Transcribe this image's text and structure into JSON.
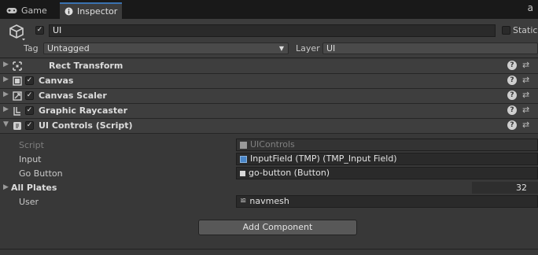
{
  "tabs": [
    {
      "label": "Game",
      "icon": "gamepad-icon"
    },
    {
      "label": "Inspector",
      "icon": "info-icon"
    }
  ],
  "tab_right_glyph": "a",
  "object": {
    "active": true,
    "name": "UI",
    "static_label": "Static",
    "tag_label": "Tag",
    "tag_value": "Untagged",
    "layer_label": "Layer",
    "layer_value": "UI"
  },
  "components": [
    {
      "name": "Rect Transform",
      "icon": "rect-transform-icon",
      "has_checkbox": false,
      "expanded": false
    },
    {
      "name": "Canvas",
      "icon": "canvas-icon",
      "has_checkbox": true,
      "expanded": false
    },
    {
      "name": "Canvas Scaler",
      "icon": "canvas-scaler-icon",
      "has_checkbox": true,
      "expanded": false
    },
    {
      "name": "Graphic Raycaster",
      "icon": "graphic-raycaster-icon",
      "has_checkbox": true,
      "expanded": false
    },
    {
      "name": "UI Controls (Script)",
      "icon": "script-icon",
      "has_checkbox": true,
      "expanded": true
    }
  ],
  "properties": {
    "script": {
      "label": "Script",
      "value": "UIControls"
    },
    "input": {
      "label": "Input",
      "value": "InputField (TMP) (TMP_Input Field)"
    },
    "go_button": {
      "label": "Go Button",
      "value": "go-button (Button)"
    },
    "all_plates": {
      "label": "All Plates",
      "count": "32"
    },
    "user": {
      "label": "User",
      "value": "navmesh"
    }
  },
  "add_component_label": "Add Component",
  "colors": {
    "background": "#383838",
    "tab_bar": "#191919",
    "accent": "#3a72b0",
    "field": "#2a2a2a",
    "button": "#585858"
  }
}
